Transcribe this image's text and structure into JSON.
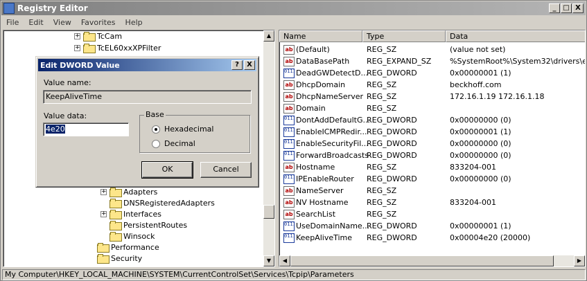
{
  "window": {
    "title": "Registry Editor",
    "controls": {
      "minimize": "_",
      "maximize": "□",
      "close": "X"
    }
  },
  "menu": [
    "File",
    "Edit",
    "View",
    "Favorites",
    "Help"
  ],
  "tree": {
    "top_items": [
      {
        "label": "TcCam",
        "expander": "+"
      },
      {
        "label": "TcEL60xxXPFilter",
        "expander": "+"
      }
    ],
    "sub_items": [
      {
        "label": "Adapters",
        "expander": "+"
      },
      {
        "label": "DNSRegisteredAdapters",
        "expander": ""
      },
      {
        "label": "Interfaces",
        "expander": "+"
      },
      {
        "label": "PersistentRoutes",
        "expander": ""
      },
      {
        "label": "Winsock",
        "expander": ""
      }
    ],
    "bottom_items": [
      {
        "label": "Performance"
      },
      {
        "label": "Security"
      }
    ]
  },
  "list": {
    "headers": {
      "name": "Name",
      "type": "Type",
      "data": "Data"
    },
    "rows": [
      {
        "icon": "ab",
        "name": "(Default)",
        "type": "REG_SZ",
        "data": "(value not set)"
      },
      {
        "icon": "ab",
        "name": "DataBasePath",
        "type": "REG_EXPAND_SZ",
        "data": "%SystemRoot%\\System32\\drivers\\etc"
      },
      {
        "icon": "bin",
        "name": "DeadGWDetectD...",
        "type": "REG_DWORD",
        "data": "0x00000001 (1)"
      },
      {
        "icon": "ab",
        "name": "DhcpDomain",
        "type": "REG_SZ",
        "data": "beckhoff.com"
      },
      {
        "icon": "ab",
        "name": "DhcpNameServer",
        "type": "REG_SZ",
        "data": "172.16.1.19 172.16.1.18"
      },
      {
        "icon": "ab",
        "name": "Domain",
        "type": "REG_SZ",
        "data": ""
      },
      {
        "icon": "bin",
        "name": "DontAddDefaultG...",
        "type": "REG_DWORD",
        "data": "0x00000000 (0)"
      },
      {
        "icon": "bin",
        "name": "EnableICMPRedir...",
        "type": "REG_DWORD",
        "data": "0x00000001 (1)"
      },
      {
        "icon": "bin",
        "name": "EnableSecurityFil...",
        "type": "REG_DWORD",
        "data": "0x00000000 (0)"
      },
      {
        "icon": "bin",
        "name": "ForwardBroadcasts",
        "type": "REG_DWORD",
        "data": "0x00000000 (0)"
      },
      {
        "icon": "ab",
        "name": "Hostname",
        "type": "REG_SZ",
        "data": "833204-001"
      },
      {
        "icon": "bin",
        "name": "IPEnableRouter",
        "type": "REG_DWORD",
        "data": "0x00000000 (0)"
      },
      {
        "icon": "ab",
        "name": "NameServer",
        "type": "REG_SZ",
        "data": ""
      },
      {
        "icon": "ab",
        "name": "NV Hostname",
        "type": "REG_SZ",
        "data": "833204-001"
      },
      {
        "icon": "ab",
        "name": "SearchList",
        "type": "REG_SZ",
        "data": ""
      },
      {
        "icon": "bin",
        "name": "UseDomainName...",
        "type": "REG_DWORD",
        "data": "0x00000001 (1)"
      },
      {
        "icon": "bin",
        "name": "KeepAliveTime",
        "type": "REG_DWORD",
        "data": "0x00004e20 (20000)"
      }
    ]
  },
  "status": "My Computer\\HKEY_LOCAL_MACHINE\\SYSTEM\\CurrentControlSet\\Services\\Tcpip\\Parameters",
  "dialog": {
    "title": "Edit DWORD Value",
    "help_btn": "?",
    "close_btn": "X",
    "value_name_label": "Value name:",
    "value_name": "KeepAliveTime",
    "value_data_label": "Value data:",
    "value_data": "4e20",
    "base_label": "Base",
    "base_options": [
      {
        "label": "Hexadecimal",
        "selected": true
      },
      {
        "label": "Decimal",
        "selected": false
      }
    ],
    "ok": "OK",
    "cancel": "Cancel"
  }
}
